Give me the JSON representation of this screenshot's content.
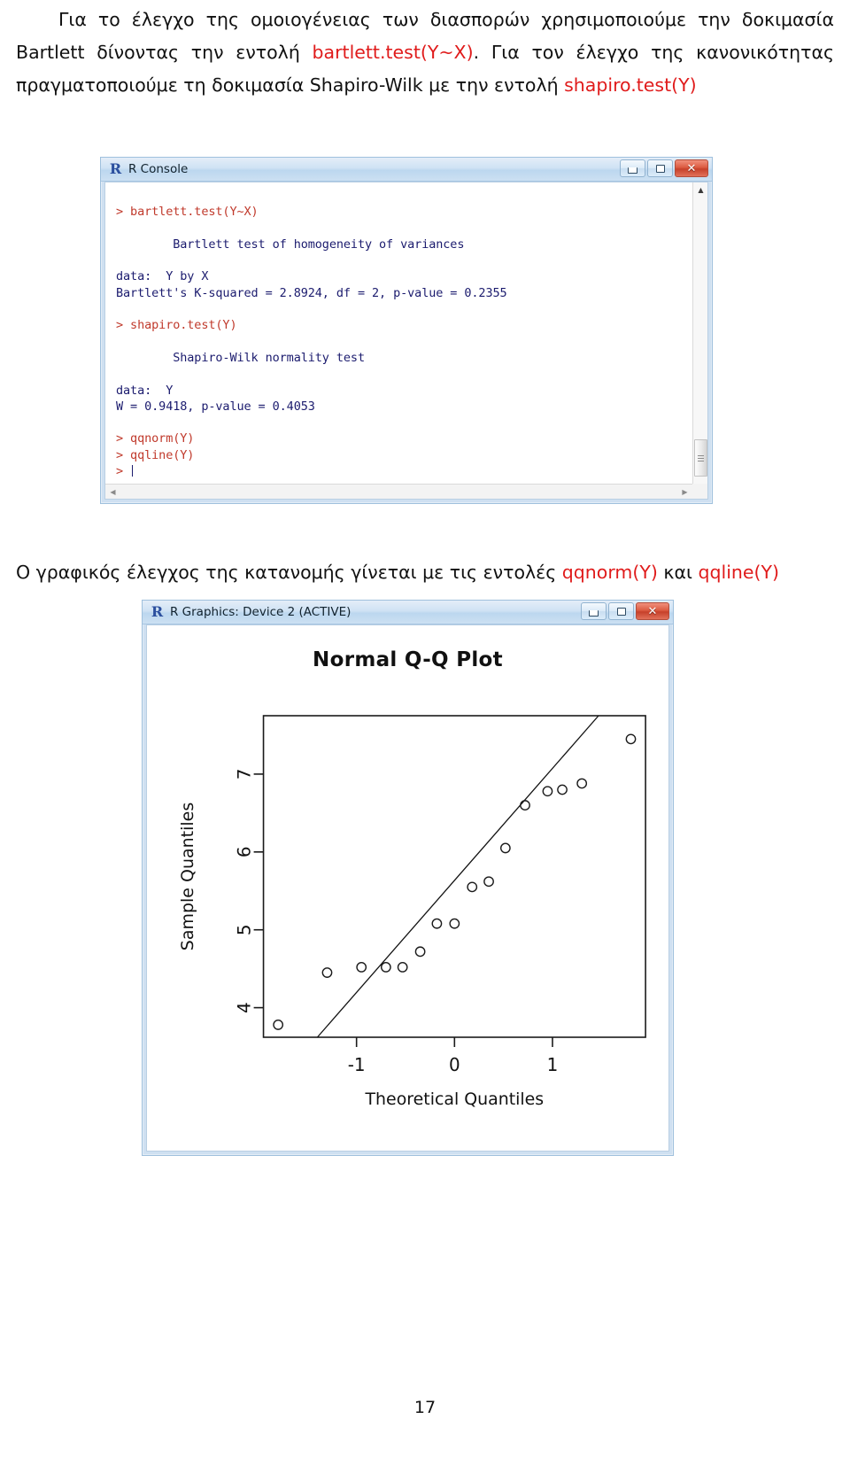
{
  "document": {
    "paragraph_top": {
      "segments": [
        {
          "text": "Για το έλεγχο της ομοιογένειας των διασπορών χρησιμοποιούμε την δοκιμασία Bartlett δίνοντας την εντολή ",
          "style": "normal"
        },
        {
          "text": "bartlett.test(Y~X)",
          "style": "code"
        },
        {
          "text": ". Για τον έλεγχο της κανονικότητας πραγματοποιούμε τη δοκιμασία Shapiro-Wilk με την εντολή ",
          "style": "normal"
        },
        {
          "text": "shapiro.test(Y)",
          "style": "code"
        }
      ],
      "plain_1": "Για το έλεγχο της ομοιογένειας των διασπορών χρησιμοποιούμε την δοκιμασία Bartlett δίνοντας την εντολή ",
      "code_1": "bartlett.test(Y~X)",
      "plain_2": ". Για τον έλεγχο της κανονικότητας πραγματοποιούμε τη δοκιμασία Shapiro-Wilk με την εντολή ",
      "code_2": "shapiro.test(Y)"
    },
    "paragraph_mid": {
      "plain_1": "Ο γραφικός έλεγχος της κατανομής γίνεται με τις εντολές ",
      "code_1": "qqnorm(Y)",
      "plain_2": " και ",
      "code_2": "qqline(Y)"
    },
    "page_number": "17",
    "accent_code_color": "#e01b1b"
  },
  "r_console_window": {
    "title": "R Console",
    "icon": "r-logo-icon",
    "buttons": {
      "minimize": "",
      "maximize": "",
      "close": "✕"
    },
    "console_lines": [
      {
        "type": "cmd",
        "text": "> bartlett.test(Y~X)"
      },
      {
        "type": "blank",
        "text": ""
      },
      {
        "type": "output",
        "text": "        Bartlett test of homogeneity of variances"
      },
      {
        "type": "blank",
        "text": ""
      },
      {
        "type": "output",
        "text": "data:  Y by X"
      },
      {
        "type": "output",
        "text": "Bartlett's K-squared = 2.8924, df = 2, p-value = 0.2355"
      },
      {
        "type": "blank",
        "text": ""
      },
      {
        "type": "cmd",
        "text": "> shapiro.test(Y)"
      },
      {
        "type": "blank",
        "text": ""
      },
      {
        "type": "output",
        "text": "        Shapiro-Wilk normality test"
      },
      {
        "type": "blank",
        "text": ""
      },
      {
        "type": "output",
        "text": "data:  Y"
      },
      {
        "type": "output",
        "text": "W = 0.9418, p-value = 0.4053"
      },
      {
        "type": "blank",
        "text": ""
      },
      {
        "type": "cmd",
        "text": "> qqnorm(Y)"
      },
      {
        "type": "cmd",
        "text": "> qqline(Y)"
      },
      {
        "type": "prompt",
        "text": "> "
      }
    ],
    "results": {
      "bartlett_k_squared": "2.8924",
      "bartlett_df": "2",
      "bartlett_p_value": "0.2355",
      "shapiro_w": "0.9418",
      "shapiro_p_value": "0.4053"
    },
    "scrollbar": {
      "up_arrow": "▲",
      "down_arrow": "▼",
      "left_arrow": "◀",
      "right_arrow": "▶"
    }
  },
  "r_graphics_window": {
    "title": "R Graphics: Device 2 (ACTIVE)",
    "icon": "r-logo-icon",
    "buttons": {
      "minimize": "",
      "maximize": "",
      "close": "✕"
    }
  },
  "chart_data": {
    "type": "scatter",
    "title": "Normal Q-Q Plot",
    "xlabel": "Theoretical Quantiles",
    "ylabel": "Sample Quantiles",
    "xticks": [
      -1,
      0,
      1
    ],
    "xtick_labels": [
      "-1",
      "0",
      "1"
    ],
    "yticks": [
      4,
      5,
      6,
      7
    ],
    "ytick_labels": [
      "4",
      "5",
      "6",
      "7"
    ],
    "xlim": [
      -1.95,
      1.95
    ],
    "ylim": [
      3.62,
      7.75
    ],
    "grid": false,
    "legend": false,
    "points": [
      {
        "x": -1.8,
        "y": 3.78
      },
      {
        "x": -1.3,
        "y": 4.45
      },
      {
        "x": -0.95,
        "y": 4.52
      },
      {
        "x": -0.7,
        "y": 4.52
      },
      {
        "x": -0.53,
        "y": 4.52
      },
      {
        "x": -0.35,
        "y": 4.72
      },
      {
        "x": -0.18,
        "y": 5.08
      },
      {
        "x": 0.0,
        "y": 5.08
      },
      {
        "x": 0.18,
        "y": 5.55
      },
      {
        "x": 0.35,
        "y": 5.62
      },
      {
        "x": 0.52,
        "y": 6.05
      },
      {
        "x": 0.72,
        "y": 6.6
      },
      {
        "x": 0.95,
        "y": 6.78
      },
      {
        "x": 1.1,
        "y": 6.8
      },
      {
        "x": 1.3,
        "y": 6.88
      },
      {
        "x": 1.8,
        "y": 7.45
      }
    ],
    "qqline": {
      "x1": -1.4,
      "y1": 3.62,
      "x2": 1.47,
      "y2": 7.75
    },
    "marker": "open-circle"
  }
}
